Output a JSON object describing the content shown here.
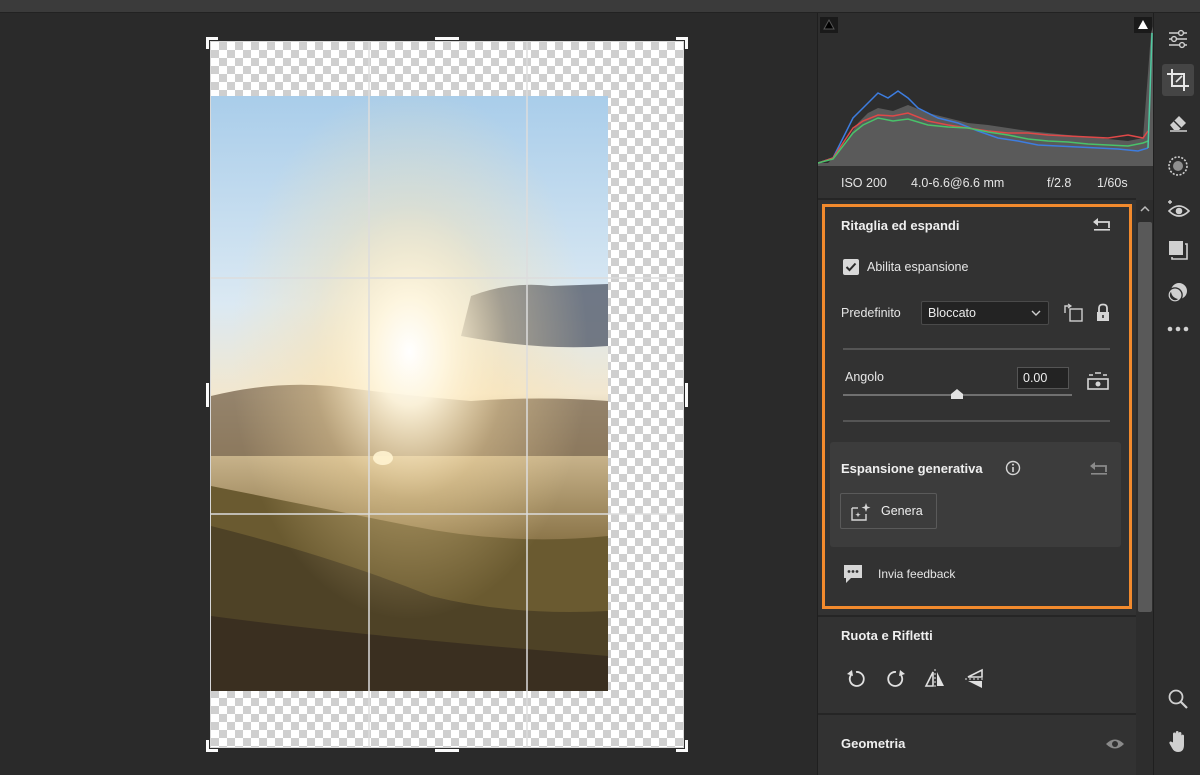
{
  "exif": {
    "iso": "ISO 200",
    "lens": "4.0-6.6@6.6 mm",
    "aperture": "f/2.8",
    "shutter": "1/60s"
  },
  "crop_panel": {
    "title": "Ritaglia ed espandi",
    "enable_expansion_label": "Abilita espansione",
    "enable_expansion_checked": true,
    "preset_label": "Predefinito",
    "preset_value": "Bloccato",
    "angle_label": "Angolo",
    "angle_value": "0.00",
    "generative": {
      "title": "Espansione generativa",
      "generate_label": "Genera"
    },
    "feedback_label": "Invia feedback"
  },
  "rotate_panel": {
    "title": "Ruota e Rifletti"
  },
  "geometry_panel": {
    "title": "Geometria"
  },
  "colors": {
    "highlight": "#f28a2d",
    "panel_bg": "#323232",
    "canvas_bg": "#2a2a2a"
  },
  "rail_tools": [
    "edit-sliders-icon",
    "crop-icon",
    "eraser-icon",
    "mask-icon",
    "red-eye-icon",
    "presets-icon",
    "snapshots-icon",
    "more-icon",
    "zoom-icon",
    "hand-icon"
  ]
}
